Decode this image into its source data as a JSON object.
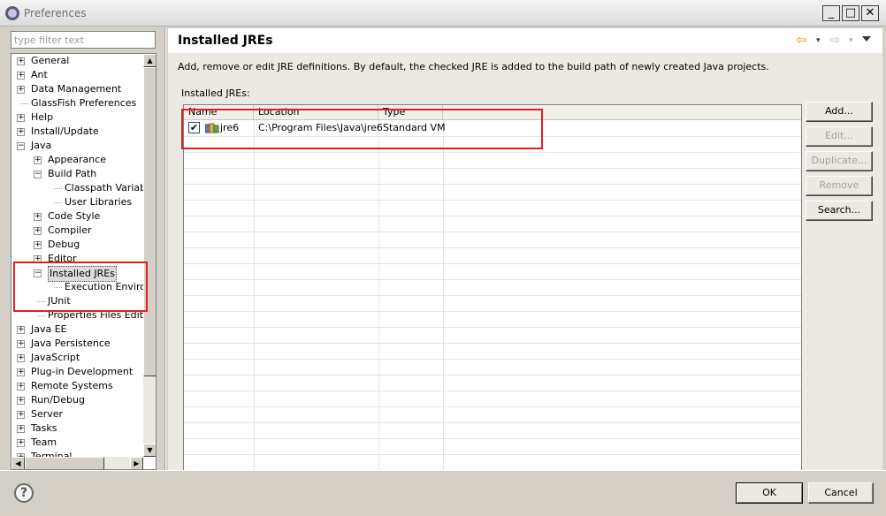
{
  "window": {
    "title": "Preferences",
    "minimize": "_",
    "maximize": "□",
    "close": "✕"
  },
  "filter": {
    "placeholder": "type filter text"
  },
  "tree": {
    "items": [
      {
        "label": "General",
        "expander": "+"
      },
      {
        "label": "Ant",
        "expander": "+"
      },
      {
        "label": "Data Management",
        "expander": "+"
      },
      {
        "label": "GlassFish Preferences",
        "expander": ""
      },
      {
        "label": "Help",
        "expander": "+"
      },
      {
        "label": "Install/Update",
        "expander": "+"
      },
      {
        "label": "Java",
        "expander": "−"
      },
      {
        "label": "Appearance",
        "expander": "+"
      },
      {
        "label": "Build Path",
        "expander": "−"
      },
      {
        "label": "Classpath Variable",
        "expander": ""
      },
      {
        "label": "User Libraries",
        "expander": ""
      },
      {
        "label": "Code Style",
        "expander": "+"
      },
      {
        "label": "Compiler",
        "expander": "+"
      },
      {
        "label": "Debug",
        "expander": "+"
      },
      {
        "label": "Editor",
        "expander": "+"
      },
      {
        "label": "Installed JREs",
        "expander": "−"
      },
      {
        "label": "Execution Environn",
        "expander": ""
      },
      {
        "label": "JUnit",
        "expander": ""
      },
      {
        "label": "Properties Files Editor",
        "expander": ""
      },
      {
        "label": "Java EE",
        "expander": "+"
      },
      {
        "label": "Java Persistence",
        "expander": "+"
      },
      {
        "label": "JavaScript",
        "expander": "+"
      },
      {
        "label": "Plug-in Development",
        "expander": "+"
      },
      {
        "label": "Remote Systems",
        "expander": "+"
      },
      {
        "label": "Run/Debug",
        "expander": "+"
      },
      {
        "label": "Server",
        "expander": "+"
      },
      {
        "label": "Tasks",
        "expander": "+"
      },
      {
        "label": "Team",
        "expander": "+"
      },
      {
        "label": "Terminal",
        "expander": "+"
      }
    ],
    "scroll_up": "▲",
    "scroll_down": "▼",
    "scroll_left": "◀",
    "scroll_right": "▶"
  },
  "page": {
    "title": "Installed JREs",
    "nav_back": "⇦",
    "nav_forward": "⇨",
    "dropdown": "▾",
    "description": "Add, remove or edit JRE definitions. By default, the checked JRE is added to the build path of newly created Java projects.",
    "installed_label": "Installed JREs:",
    "columns": [
      "Name",
      "Location",
      "Type"
    ],
    "rows": [
      {
        "checked": "✔",
        "name": "jre6",
        "location": "C:\\Program Files\\Java\\jre6",
        "type": "Standard VM"
      }
    ],
    "buttons": {
      "add": "Add...",
      "edit": "Edit...",
      "duplicate": "Duplicate...",
      "remove": "Remove",
      "search": "Search..."
    }
  },
  "footer": {
    "help": "?",
    "ok": "OK",
    "cancel": "Cancel"
  },
  "colors": {
    "highlight_box": "#e02020",
    "back_arrow": "#d4a000"
  }
}
